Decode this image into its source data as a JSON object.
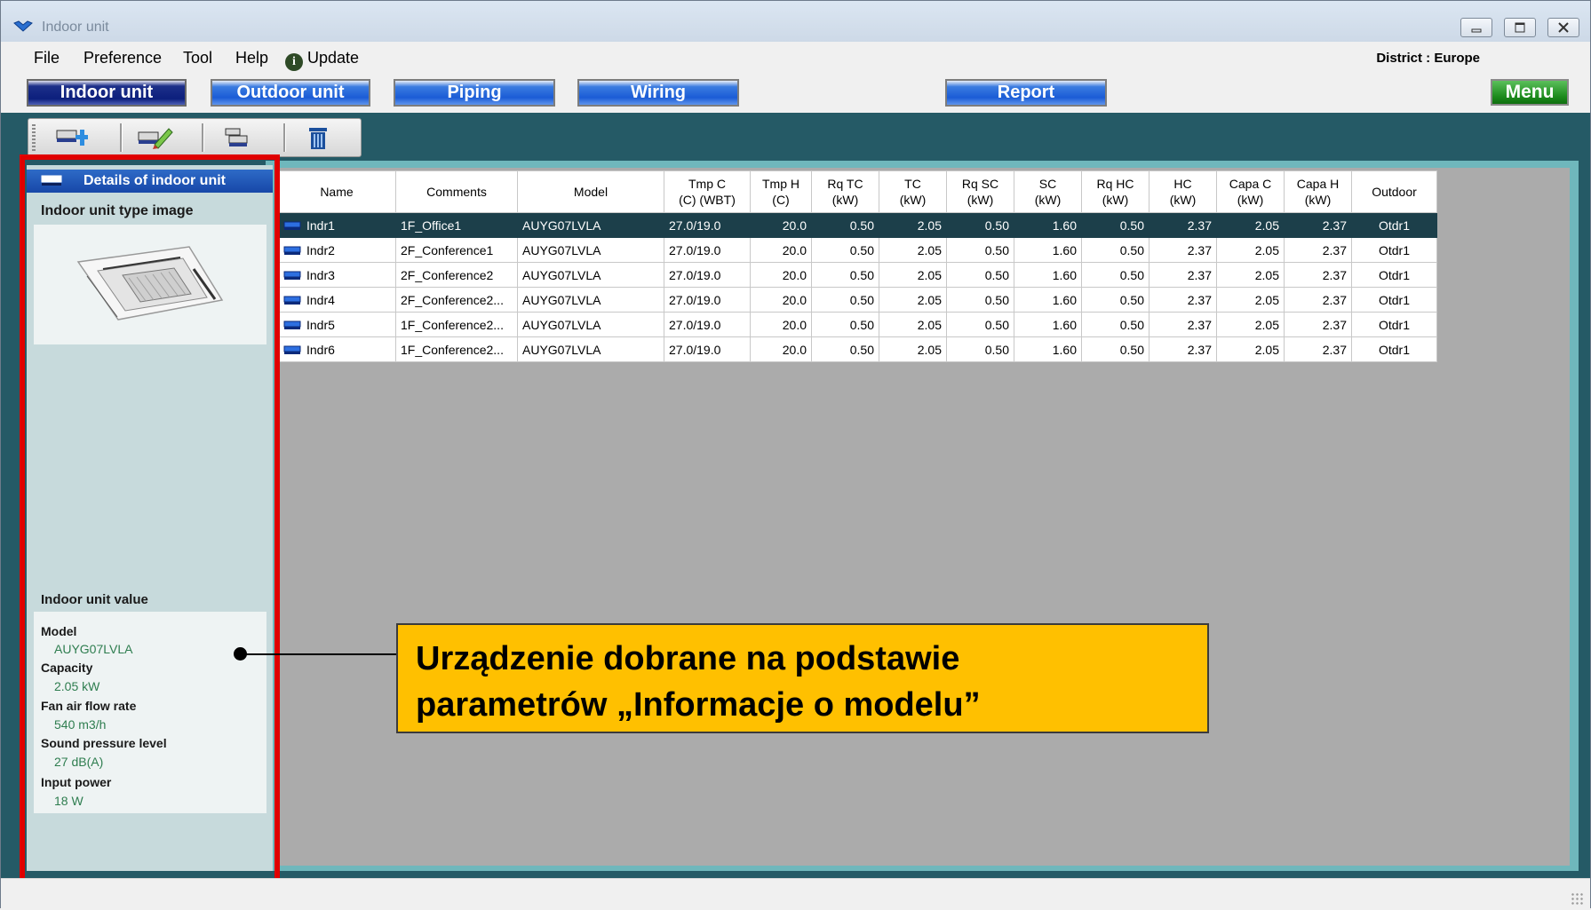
{
  "window": {
    "title": "Indoor unit",
    "controls": [
      "minimize",
      "maximize",
      "close"
    ]
  },
  "menubar": {
    "items": [
      "File",
      "Preference",
      "Tool",
      "Help",
      "Update"
    ],
    "district": "District : Europe"
  },
  "nav": {
    "buttons": [
      "Indoor unit",
      "Outdoor unit",
      "Piping",
      "Wiring",
      "Report"
    ],
    "active": "Indoor unit",
    "menu": "Menu"
  },
  "toolbar": {
    "icons": [
      "add-unit-icon",
      "edit-unit-icon",
      "copy-unit-icon",
      "delete-icon"
    ]
  },
  "panel": {
    "header": "Details of indoor unit",
    "image_label": "Indoor unit type image",
    "values_label": "Indoor unit value",
    "values": [
      {
        "key": "Model",
        "value": "AUYG07LVLA"
      },
      {
        "key": "Capacity",
        "value": "2.05 kW"
      },
      {
        "key": "Fan air flow rate",
        "value": "540 m3/h"
      },
      {
        "key": "Sound pressure level",
        "value": "27 dB(A)"
      },
      {
        "key": "Input power",
        "value": "18 W"
      }
    ]
  },
  "table": {
    "columns": [
      [
        "Name"
      ],
      [
        "Comments"
      ],
      [
        "Model"
      ],
      [
        "Tmp C",
        "(C) (WBT)"
      ],
      [
        "Tmp H",
        "(C)"
      ],
      [
        "Rq TC",
        "(kW)"
      ],
      [
        "TC",
        "(kW)"
      ],
      [
        "Rq SC",
        "(kW)"
      ],
      [
        "SC",
        "(kW)"
      ],
      [
        "Rq HC",
        "(kW)"
      ],
      [
        "HC",
        "(kW)"
      ],
      [
        "Capa C",
        "(kW)"
      ],
      [
        "Capa H",
        "(kW)"
      ],
      [
        "Outdoor"
      ]
    ],
    "selected_row": 0,
    "rows": [
      [
        "Indr1",
        "1F_Office1",
        "AUYG07LVLA",
        "27.0/19.0",
        "20.0",
        "0.50",
        "2.05",
        "0.50",
        "1.60",
        "0.50",
        "2.37",
        "2.05",
        "2.37",
        "Otdr1"
      ],
      [
        "Indr2",
        "2F_Conference1",
        "AUYG07LVLA",
        "27.0/19.0",
        "20.0",
        "0.50",
        "2.05",
        "0.50",
        "1.60",
        "0.50",
        "2.37",
        "2.05",
        "2.37",
        "Otdr1"
      ],
      [
        "Indr3",
        "2F_Conference2",
        "AUYG07LVLA",
        "27.0/19.0",
        "20.0",
        "0.50",
        "2.05",
        "0.50",
        "1.60",
        "0.50",
        "2.37",
        "2.05",
        "2.37",
        "Otdr1"
      ],
      [
        "Indr4",
        "2F_Conference2...",
        "AUYG07LVLA",
        "27.0/19.0",
        "20.0",
        "0.50",
        "2.05",
        "0.50",
        "1.60",
        "0.50",
        "2.37",
        "2.05",
        "2.37",
        "Otdr1"
      ],
      [
        "Indr5",
        "1F_Conference2...",
        "AUYG07LVLA",
        "27.0/19.0",
        "20.0",
        "0.50",
        "2.05",
        "0.50",
        "1.60",
        "0.50",
        "2.37",
        "2.05",
        "2.37",
        "Otdr1"
      ],
      [
        "Indr6",
        "1F_Conference2...",
        "AUYG07LVLA",
        "27.0/19.0",
        "20.0",
        "0.50",
        "2.05",
        "0.50",
        "1.60",
        "0.50",
        "2.37",
        "2.05",
        "2.37",
        "Otdr1"
      ]
    ]
  },
  "callout": {
    "line1": "Urządzenie dobrane na podstawie",
    "line2": "parametrów „Informacje o modelu”"
  },
  "colors": {
    "teal_dark": "#255a66",
    "panel_bg": "#c7dadc",
    "selected_row": "#1c3f4a",
    "highlight_frame": "#e00000",
    "callout_bg": "#ffc000",
    "value_text": "#2e7d4f"
  }
}
